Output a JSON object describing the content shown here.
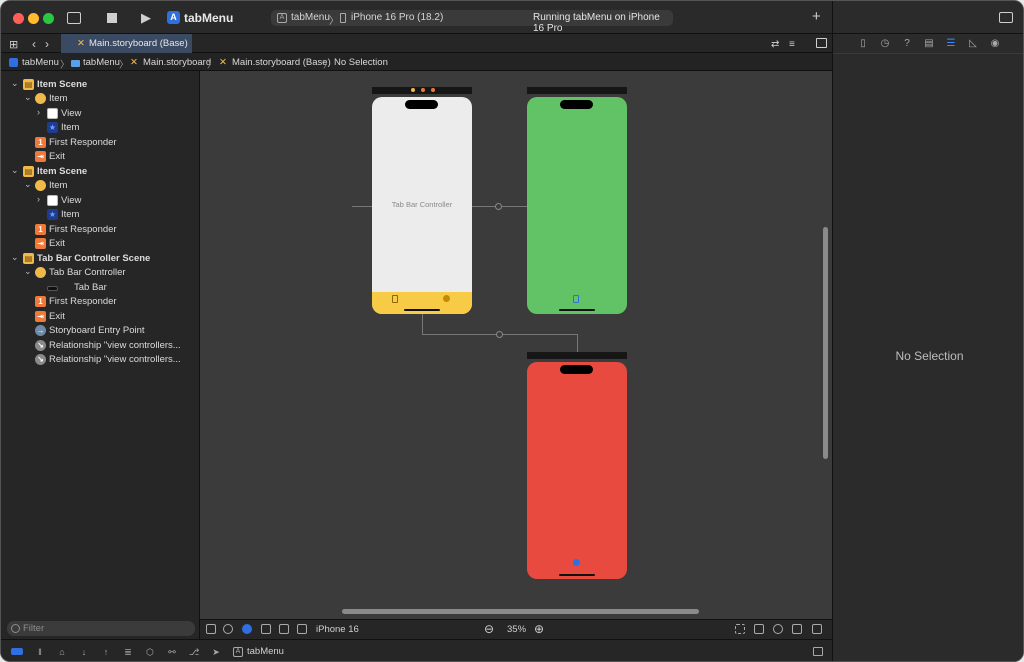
{
  "window": {
    "app_title": "tabMenu",
    "scheme": {
      "project": "tabMenu",
      "separator": "〉",
      "device": "iPhone 16 Pro (18.2)"
    },
    "run_status": "Running tabMenu on iPhone 16 Pro",
    "add_button": "+"
  },
  "editor_tab": {
    "label": "Main.storyboard (Base)"
  },
  "jumpbar": {
    "items": [
      "tabMenu",
      "tabMenu",
      "Main.storyboard",
      "Main.storyboard (Base)",
      "No Selection"
    ],
    "sep": "〉"
  },
  "navigator": {
    "rows": [
      {
        "label": "Item Scene",
        "bold": true
      },
      {
        "label": "Item"
      },
      {
        "label": "View"
      },
      {
        "label": "Item"
      },
      {
        "label": "First Responder"
      },
      {
        "label": "Exit"
      },
      {
        "label": "Item Scene",
        "bold": true
      },
      {
        "label": "Item"
      },
      {
        "label": "View"
      },
      {
        "label": "Item"
      },
      {
        "label": "First Responder"
      },
      {
        "label": "Exit"
      },
      {
        "label": "Tab Bar Controller Scene",
        "bold": true
      },
      {
        "label": "Tab Bar Controller"
      },
      {
        "label": "Tab Bar"
      },
      {
        "label": "First Responder"
      },
      {
        "label": "Exit"
      },
      {
        "label": "Storyboard Entry Point"
      },
      {
        "label": "Relationship \"view controllers..."
      },
      {
        "label": "Relationship \"view controllers..."
      }
    ],
    "filter_placeholder": "Filter"
  },
  "canvas": {
    "tab_bar_controller_label": "Tab Bar Controller",
    "colors": {
      "white_scene": "#ececec",
      "green_scene": "#62c366",
      "red_scene": "#e94a3f",
      "tab_bar": "#f7cb46"
    }
  },
  "canvas_bar": {
    "device": "iPhone 16",
    "zoom": "35%",
    "zoom_out": "⊖",
    "zoom_in": "⊕"
  },
  "inspector": {
    "empty_text": "No Selection"
  },
  "statusbar": {
    "scheme": "tabMenu"
  }
}
